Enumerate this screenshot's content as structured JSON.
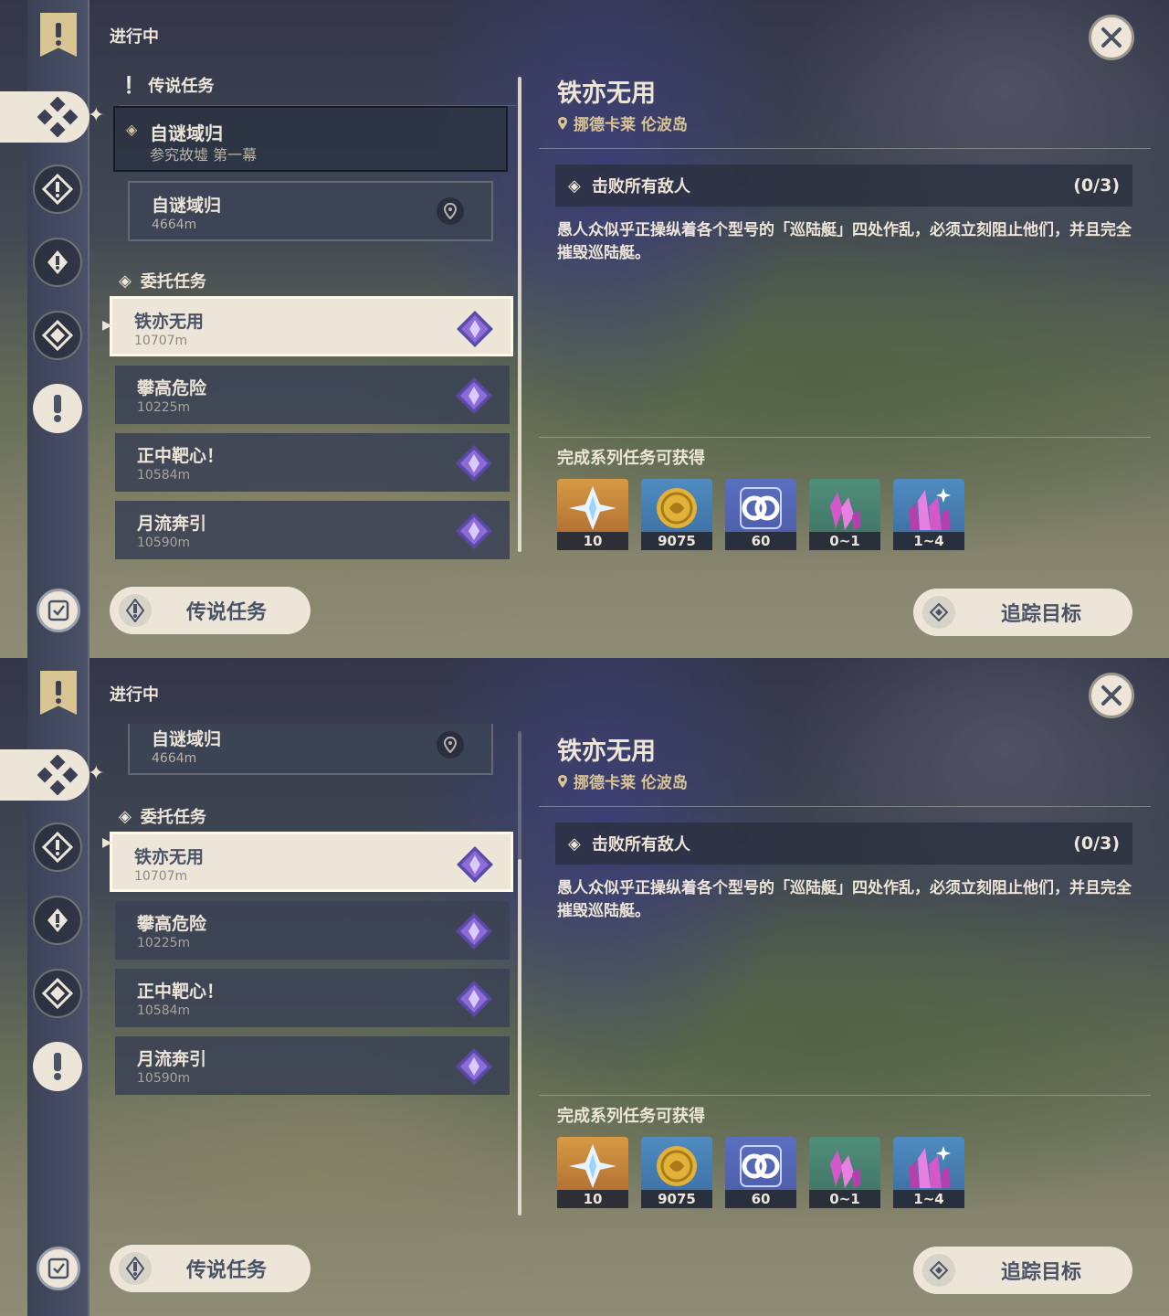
{
  "status_title": "进行中",
  "sections": {
    "legend": "传说任务",
    "commission": "委托任务"
  },
  "legend_quest": {
    "title": "自谜域归",
    "subtitle": "参究故墟 第一幕"
  },
  "legend_subquest": {
    "title": "自谜域归",
    "distance": "4664m"
  },
  "tasks": [
    {
      "title": "铁亦无用",
      "distance": "10707m",
      "selected": true
    },
    {
      "title": "攀高危险",
      "distance": "10225m",
      "selected": false
    },
    {
      "title": "正中靶心！",
      "distance": "10584m",
      "selected": false
    },
    {
      "title": "月流奔引",
      "distance": "10590m",
      "selected": false
    }
  ],
  "detail": {
    "title": "铁亦无用",
    "location": "挪德卡莱 伦波岛",
    "objective": "击败所有敌人",
    "objective_progress": "(0/3)",
    "description": "愚人众似乎正操纵着各个型号的「巡陆艇」四处作乱，必须立刻阻止他们，并且完全摧毁巡陆艇。",
    "reward_title": "完成系列任务可获得",
    "rewards": [
      {
        "icon": "primogem-icon",
        "qty": "10"
      },
      {
        "icon": "mora-icon",
        "qty": "9075"
      },
      {
        "icon": "fetters-icon",
        "qty": "60"
      },
      {
        "icon": "crystal-small-icon",
        "qty": "0~1"
      },
      {
        "icon": "crystal-large-icon",
        "qty": "1~4"
      }
    ]
  },
  "buttons": {
    "legend": "传说任务",
    "track": "追踪目标"
  },
  "colors": {
    "panel_cream": "#ece5d8",
    "dark_text": "#4a5366",
    "gold": "#d9c493",
    "gem_purple": "#8e6cd8"
  }
}
